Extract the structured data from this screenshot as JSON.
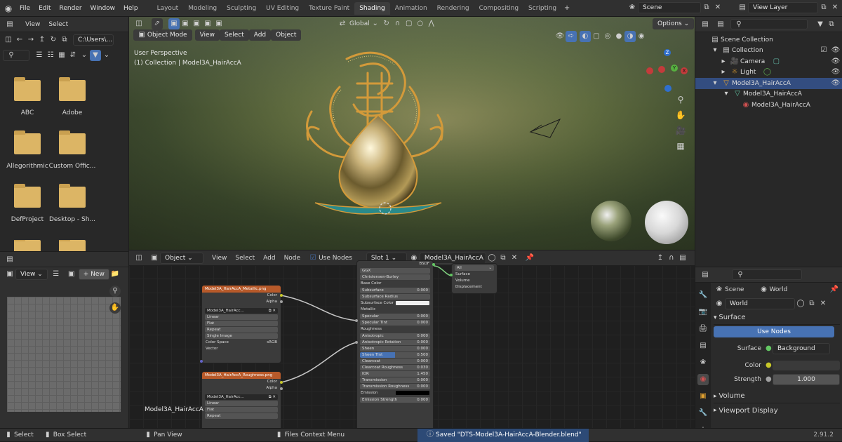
{
  "menu": [
    "File",
    "Edit",
    "Render",
    "Window",
    "Help"
  ],
  "workspaces": [
    "Layout",
    "Modeling",
    "Sculpting",
    "UV Editing",
    "Texture Paint",
    "Shading",
    "Animation",
    "Rendering",
    "Compositing",
    "Scripting"
  ],
  "active_workspace": "Shading",
  "scene": "Scene",
  "view_layer": "View Layer",
  "filebrowser": {
    "menu": [
      "View",
      "Select"
    ],
    "path": "C:\\Users\\...",
    "items": [
      "ABC",
      "Adobe",
      "Allegorithmic",
      "Custom Offic...",
      "DefProject",
      "Desktop - Sh..."
    ]
  },
  "viewport": {
    "mode": "Object Mode",
    "menu": [
      "View",
      "Select",
      "Add",
      "Object"
    ],
    "orientation": "Global",
    "options": "Options",
    "overlay_line1": "User Perspective",
    "overlay_line2": "(1) Collection | Model3A_HairAccA",
    "axes": {
      "z": "Z",
      "y": "Y",
      "x": "X"
    }
  },
  "outliner": {
    "title": "Scene Collection",
    "rows": [
      {
        "label": "Collection",
        "indent": 1
      },
      {
        "label": "Camera",
        "indent": 2
      },
      {
        "label": "Light",
        "indent": 2
      },
      {
        "label": "Model3A_HairAccA",
        "indent": 1
      },
      {
        "label": "Model3A_HairAccA",
        "indent": 2
      },
      {
        "label": "Model3A_HairAccA",
        "indent": 3
      }
    ]
  },
  "image_editor": {
    "view": "View",
    "new": "New"
  },
  "node_editor": {
    "type": "Object",
    "menu": [
      "View",
      "Select",
      "Add",
      "Node"
    ],
    "use_nodes": "Use Nodes",
    "slot": "Slot 1",
    "material": "Model3A_HairAccA",
    "footer_label": "Model3A_HairAccA",
    "node1": {
      "title": "Model3A_HairAccA_Metallic.png",
      "out": [
        "Color",
        "Alpha"
      ],
      "img": "Model3A_HairAcc...",
      "fields": [
        "Linear",
        "Flat",
        "Repeat",
        "Single Image"
      ],
      "colorspace_label": "Color Space",
      "colorspace": "sRGB",
      "vector": "Vector"
    },
    "node2": {
      "title": "Model3A_HairAccA_Roughness.png",
      "out": [
        "Color",
        "Alpha"
      ],
      "img": "Model3A_HairAcc...",
      "fields": [
        "Linear",
        "Flat",
        "Repeat"
      ]
    },
    "bsdf": {
      "out": "BSDF",
      "dropdowns": [
        "GGX",
        "Christensen-Burley"
      ],
      "rows": [
        {
          "label": "Base Color",
          "value": ""
        },
        {
          "label": "Subsurface",
          "value": "0.000"
        },
        {
          "label": "Subsurface Radius",
          "value": ""
        },
        {
          "label": "Subsurface Color",
          "value": ""
        },
        {
          "label": "Metallic",
          "value": ""
        },
        {
          "label": "Specular",
          "value": "0.000"
        },
        {
          "label": "Specular Tint",
          "value": "0.000"
        },
        {
          "label": "Roughness",
          "value": ""
        },
        {
          "label": "Anisotropic",
          "value": "0.000"
        },
        {
          "label": "Anisotropic Rotation",
          "value": "0.000"
        },
        {
          "label": "Sheen",
          "value": "0.000"
        },
        {
          "label": "Sheen Tint",
          "value": "0.500"
        },
        {
          "label": "Clearcoat",
          "value": "0.000"
        },
        {
          "label": "Clearcoat Roughness",
          "value": "0.030"
        },
        {
          "label": "IOR",
          "value": "1.450"
        },
        {
          "label": "Transmission",
          "value": "0.000"
        },
        {
          "label": "Transmission Roughness",
          "value": "0.000"
        },
        {
          "label": "Emission",
          "value": ""
        },
        {
          "label": "Emission Strength",
          "value": "0.000"
        }
      ]
    },
    "output": {
      "target": "All",
      "inputs": [
        "Surface",
        "Volume",
        "Displacement"
      ]
    }
  },
  "properties": {
    "scene": "Scene",
    "world": "World",
    "world_field": "World",
    "surface": "Surface",
    "use_nodes": "Use Nodes",
    "surface_label": "Surface",
    "surface_value": "Background",
    "color_label": "Color",
    "strength_label": "Strength",
    "strength_value": "1.000",
    "volume": "Volume",
    "viewport_display": "Viewport Display"
  },
  "status": {
    "select": "Select",
    "box_select": "Box Select",
    "pan_view": "Pan View",
    "context": "Files Context Menu",
    "message": "Saved \"DTS-Model3A-HairAccA-Blender.blend\"",
    "version": "2.91.2"
  },
  "colors": {
    "accent": "#4772b3",
    "panel": "#303030",
    "bg": "#1d1d1d",
    "node_header": "#b85a2a"
  }
}
